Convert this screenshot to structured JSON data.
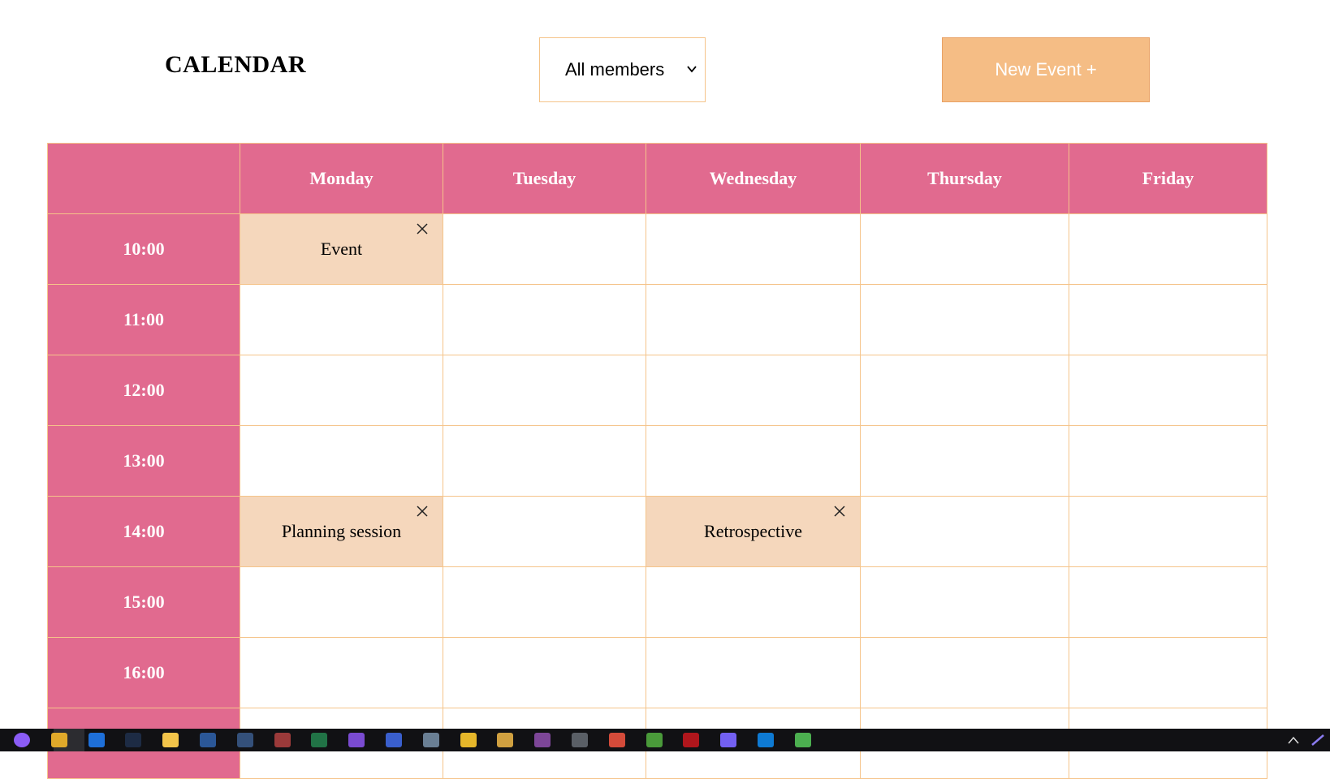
{
  "header": {
    "title": "CALENDAR",
    "member_filter": {
      "selected": "All members"
    },
    "new_event_label": "New Event +"
  },
  "calendar": {
    "days": [
      "Monday",
      "Tuesday",
      "Wednesday",
      "Thursday",
      "Friday"
    ],
    "times": [
      "10:00",
      "11:00",
      "12:00",
      "13:00",
      "14:00",
      "15:00",
      "16:00",
      ""
    ],
    "events": [
      {
        "day": "Monday",
        "time": "10:00",
        "name": "Event"
      },
      {
        "day": "Monday",
        "time": "14:00",
        "name": "Planning session"
      },
      {
        "day": "Wednesday",
        "time": "14:00",
        "name": "Retrospective"
      }
    ]
  },
  "colors": {
    "header_bg": "#e16a8f",
    "border": "#f5c48a",
    "event_bg": "#f5d7bc",
    "button_bg": "#f5bd85"
  },
  "taskbar": {
    "icons": [
      {
        "name": "cortana-icon",
        "color": "#8b5cf6"
      },
      {
        "name": "chrome-icon",
        "color": "#e0a92a"
      },
      {
        "name": "edge-icon",
        "color": "#1e6fd8"
      },
      {
        "name": "lightroom-icon",
        "color": "#1d2b44"
      },
      {
        "name": "file-explorer-icon",
        "color": "#f3c44a"
      },
      {
        "name": "word-icon",
        "color": "#2b5797"
      },
      {
        "name": "app-icon",
        "color": "#34507a"
      },
      {
        "name": "winrar-icon",
        "color": "#9b3a3a"
      },
      {
        "name": "excel-icon",
        "color": "#217346"
      },
      {
        "name": "visual-studio-icon",
        "color": "#7a4bd1"
      },
      {
        "name": "save-icon",
        "color": "#3a5fcd"
      },
      {
        "name": "network-icon",
        "color": "#6a7f94"
      },
      {
        "name": "plex-icon",
        "color": "#e5b62a"
      },
      {
        "name": "magic-wand-icon",
        "color": "#d0a040"
      },
      {
        "name": "tor-icon",
        "color": "#7d4698"
      },
      {
        "name": "camera-icon",
        "color": "#5a5f66"
      },
      {
        "name": "ccleaner-icon",
        "color": "#d44b3a"
      },
      {
        "name": "utorrent-icon",
        "color": "#4a9a3a"
      },
      {
        "name": "filezilla-icon",
        "color": "#b0161c"
      },
      {
        "name": "viber-icon",
        "color": "#7360f2"
      },
      {
        "name": "vscode-icon",
        "color": "#0e7ad3"
      },
      {
        "name": "notepad-icon",
        "color": "#4caf50"
      }
    ]
  }
}
